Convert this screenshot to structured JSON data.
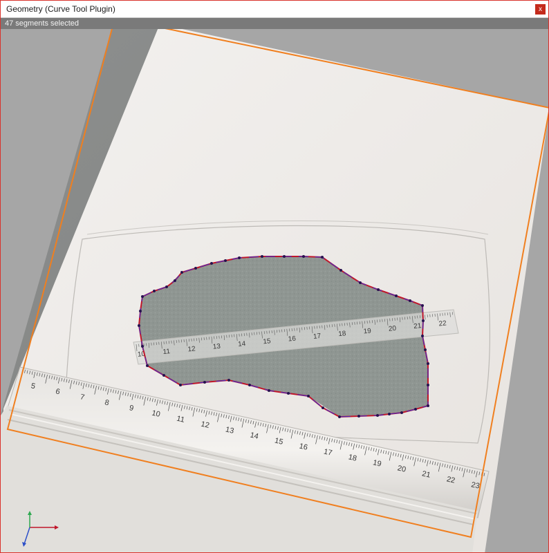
{
  "window": {
    "title": "Geometry (Curve Tool Plugin)",
    "close_label": "x"
  },
  "status": {
    "text": "47 segments selected"
  },
  "viewport": {
    "selection_color": "#f07f1f",
    "curve_colors": [
      "#c0162a",
      "#4b2bb8"
    ],
    "background": "#a6a6a6"
  },
  "rulers": {
    "long_ruler_labels": [
      "5",
      "6",
      "7",
      "8",
      "9",
      "10",
      "11",
      "12",
      "13",
      "14",
      "15",
      "16",
      "17",
      "18",
      "19",
      "20",
      "21",
      "22",
      "23"
    ],
    "short_ruler_labels": [
      "10",
      "11",
      "12",
      "13",
      "14",
      "15",
      "16",
      "17",
      "18",
      "19",
      "20",
      "21",
      "22"
    ]
  },
  "axes": {
    "x_color": "#c0162a",
    "y_color": "#2fa84f",
    "z_color": "#2c4fc8"
  }
}
